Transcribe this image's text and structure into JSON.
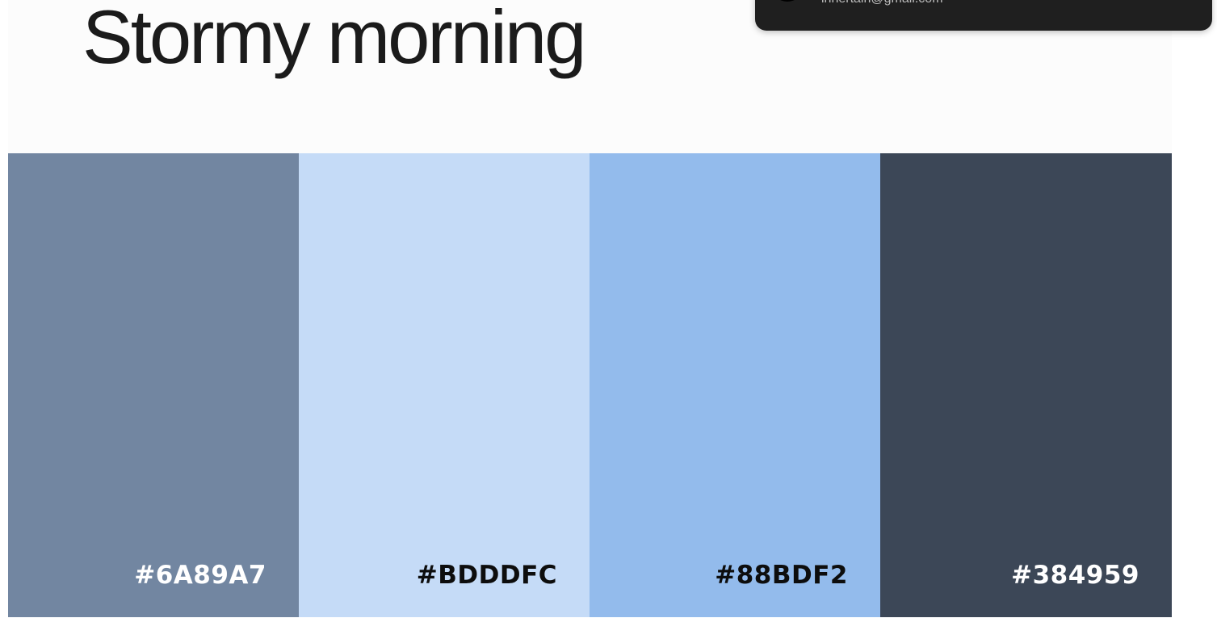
{
  "palette": {
    "title": "Stormy morning",
    "swatches": [
      {
        "hex": "#6A89A7",
        "color": "#7286a1",
        "text_color": "#ffffff"
      },
      {
        "hex": "#BDDDFC",
        "color": "#c5dbf7",
        "text_color": "#0d0d0d"
      },
      {
        "hex": "#88BDF2",
        "color": "#93bbec",
        "text_color": "#0d0d0d"
      },
      {
        "hex": "#384959",
        "color": "#3c4757",
        "text_color": "#ffffff"
      }
    ]
  },
  "notification": {
    "email": "innertain@gmail.com",
    "avatar_icon": "avatar-icon"
  }
}
